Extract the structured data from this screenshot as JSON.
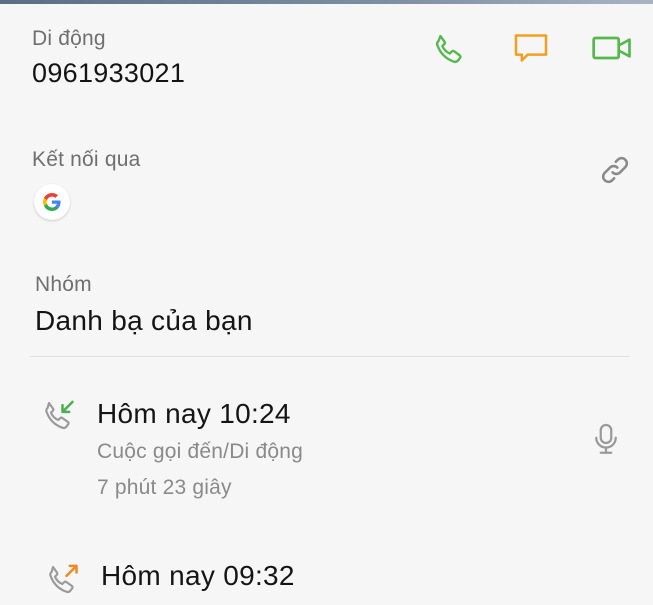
{
  "mobile": {
    "label": "Di động",
    "number": "0961933021"
  },
  "connected": {
    "label": "Kết nối qua"
  },
  "group": {
    "label": "Nhóm",
    "value": "Danh bạ của bạn"
  },
  "call_log": [
    {
      "time": "Hôm nay 10:24",
      "type": "Cuộc gọi đến/Di động",
      "duration": "7 phút 23 giây"
    },
    {
      "time": "Hôm nay 09:32"
    }
  ],
  "colors": {
    "call_green": "#56b84c",
    "message_orange": "#f2a01d",
    "incoming_arrow": "#4caf50",
    "outgoing_arrow": "#f08a24"
  },
  "icons": {
    "call": "phone-icon",
    "message": "message-icon",
    "video": "video-call-icon",
    "link": "link-icon",
    "account": "google-logo-icon",
    "incoming": "incoming-call-icon",
    "outgoing": "outgoing-call-icon",
    "recording": "microphone-icon"
  }
}
